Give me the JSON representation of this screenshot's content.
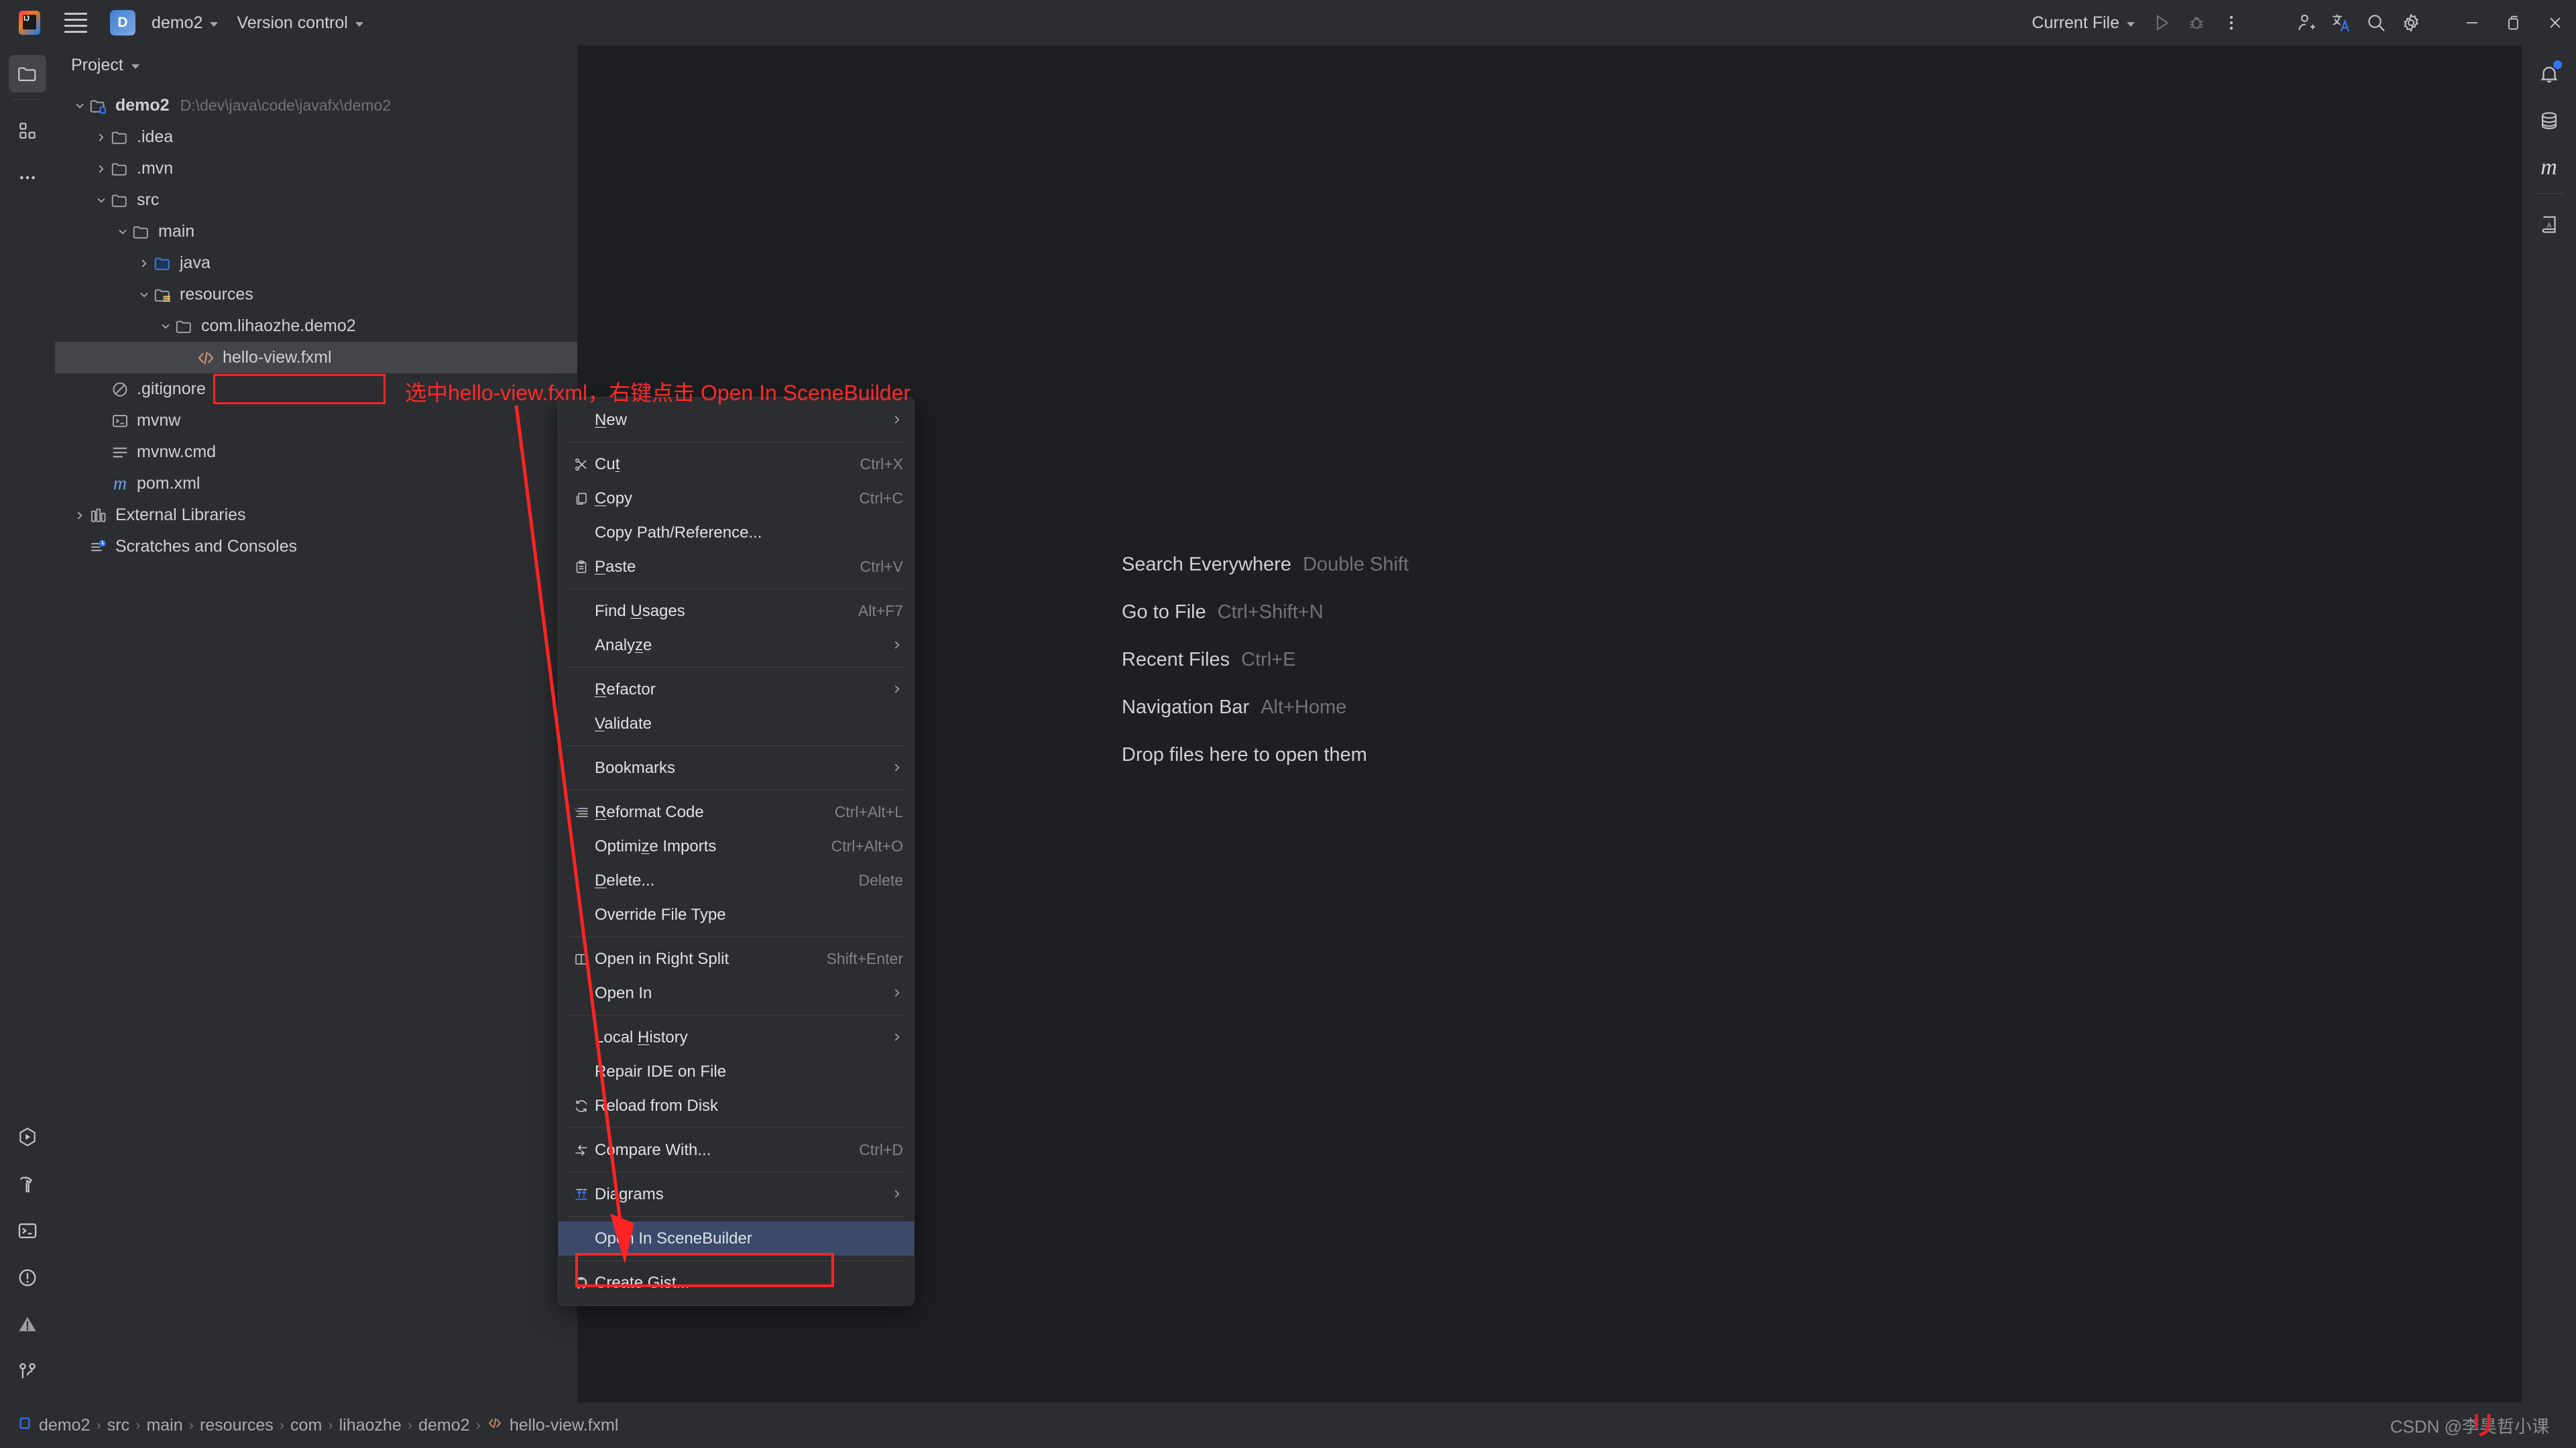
{
  "titlebar": {
    "logo_text": "IJ",
    "project_badge": "D",
    "project_name": "demo2",
    "version_control": "Version control",
    "run_config": "Current File",
    "icons": {
      "hamburger": "hamburger-menu-icon",
      "run": "run-icon",
      "debug": "debug-icon",
      "more": "more-vertical-icon",
      "add_user": "add-user-icon",
      "translate": "translate-icon",
      "search": "search-icon",
      "settings": "settings-gear-icon",
      "minimize": "minimize-icon",
      "maximize": "maximize-restore-icon",
      "close": "close-icon"
    }
  },
  "left_rail": {
    "items": [
      {
        "name": "project-tool-window",
        "icon": "folder-icon",
        "active": true
      },
      {
        "name": "commit-tool-window",
        "icon": "commit-grid-icon",
        "active": false
      },
      {
        "name": "more-tool-windows",
        "icon": "ellipsis-icon",
        "active": false
      }
    ],
    "bottom_items": [
      {
        "name": "run-tool-window",
        "icon": "run-hexagon-icon"
      },
      {
        "name": "build-tool-window",
        "icon": "hammer-icon"
      },
      {
        "name": "terminal-tool-window",
        "icon": "terminal-icon"
      },
      {
        "name": "problems-tool-window",
        "icon": "exclamation-circle-icon"
      },
      {
        "name": "warnings-tool-window",
        "icon": "warning-triangle-icon"
      },
      {
        "name": "version-control-tool-window",
        "icon": "git-branch-icon"
      }
    ]
  },
  "right_rail": {
    "items": [
      {
        "name": "notifications",
        "icon": "bell-icon",
        "badge": true
      },
      {
        "name": "database",
        "icon": "database-icon",
        "badge": false
      },
      {
        "name": "maven",
        "icon": "maven-m-icon",
        "badge": false
      },
      {
        "name": "translation-dictionary",
        "icon": "book-a-icon",
        "badge": false
      }
    ]
  },
  "project_panel": {
    "title": "Project",
    "tree": [
      {
        "depth": 0,
        "arrow": "down",
        "icon": "module-folder-icon",
        "label": "demo2",
        "path": "D:\\dev\\java\\code\\javafx\\demo2",
        "selected": false,
        "bold": true
      },
      {
        "depth": 1,
        "arrow": "right",
        "icon": "folder-icon",
        "label": ".idea",
        "path": "",
        "selected": false,
        "bold": false
      },
      {
        "depth": 1,
        "arrow": "right",
        "icon": "folder-icon",
        "label": ".mvn",
        "path": "",
        "selected": false,
        "bold": false
      },
      {
        "depth": 1,
        "arrow": "down",
        "icon": "folder-icon",
        "label": "src",
        "path": "",
        "selected": false,
        "bold": false
      },
      {
        "depth": 2,
        "arrow": "down",
        "icon": "folder-icon",
        "label": "main",
        "path": "",
        "selected": false,
        "bold": false
      },
      {
        "depth": 3,
        "arrow": "right",
        "icon": "source-folder-icon",
        "label": "java",
        "path": "",
        "selected": false,
        "bold": false
      },
      {
        "depth": 3,
        "arrow": "down",
        "icon": "resources-folder-icon",
        "label": "resources",
        "path": "",
        "selected": false,
        "bold": false
      },
      {
        "depth": 4,
        "arrow": "down",
        "icon": "folder-icon",
        "label": "com.lihaozhe.demo2",
        "path": "",
        "selected": false,
        "bold": false
      },
      {
        "depth": 5,
        "arrow": "none",
        "icon": "fxml-file-icon",
        "label": "hello-view.fxml",
        "path": "",
        "selected": true,
        "bold": false
      },
      {
        "depth": 1,
        "arrow": "none",
        "icon": "gitignore-icon",
        "label": ".gitignore",
        "path": "",
        "selected": false,
        "bold": false
      },
      {
        "depth": 1,
        "arrow": "none",
        "icon": "shell-script-icon",
        "label": "mvnw",
        "path": "",
        "selected": false,
        "bold": false
      },
      {
        "depth": 1,
        "arrow": "none",
        "icon": "cmd-file-icon",
        "label": "mvnw.cmd",
        "path": "",
        "selected": false,
        "bold": false
      },
      {
        "depth": 1,
        "arrow": "none",
        "icon": "maven-pom-icon",
        "label": "pom.xml",
        "path": "",
        "selected": false,
        "bold": false
      },
      {
        "depth": 0,
        "arrow": "right",
        "icon": "libraries-icon",
        "label": "External Libraries",
        "path": "",
        "selected": false,
        "bold": false
      },
      {
        "depth": 0,
        "arrow": "none",
        "icon": "scratches-icon",
        "label": "Scratches and Consoles",
        "path": "",
        "selected": false,
        "bold": false
      }
    ]
  },
  "editor": {
    "hints": [
      {
        "name": "Search Everywhere",
        "key": "Double Shift"
      },
      {
        "name": "Go to File",
        "key": "Ctrl+Shift+N"
      },
      {
        "name": "Recent Files",
        "key": "Ctrl+E"
      },
      {
        "name": "Navigation Bar",
        "key": "Alt+Home"
      },
      {
        "name": "Drop files here to open them",
        "key": ""
      }
    ]
  },
  "context_menu": {
    "items": [
      {
        "type": "item",
        "label": "New",
        "mnemonic": "N",
        "key": "",
        "icon": "",
        "submenu": true,
        "highlight": false
      },
      {
        "type": "sep"
      },
      {
        "type": "item",
        "label": "Cut",
        "mnemonic": "t",
        "key": "Ctrl+X",
        "icon": "scissors-icon",
        "submenu": false,
        "highlight": false
      },
      {
        "type": "item",
        "label": "Copy",
        "mnemonic": "C",
        "key": "Ctrl+C",
        "icon": "copy-icon",
        "submenu": false,
        "highlight": false
      },
      {
        "type": "item",
        "label": "Copy Path/Reference...",
        "mnemonic": "",
        "key": "",
        "icon": "",
        "submenu": false,
        "highlight": false
      },
      {
        "type": "item",
        "label": "Paste",
        "mnemonic": "P",
        "key": "Ctrl+V",
        "icon": "paste-icon",
        "submenu": false,
        "highlight": false
      },
      {
        "type": "sep"
      },
      {
        "type": "item",
        "label": "Find Usages",
        "mnemonic": "U",
        "key": "Alt+F7",
        "icon": "",
        "submenu": false,
        "highlight": false
      },
      {
        "type": "item",
        "label": "Analyze",
        "mnemonic": "z",
        "key": "",
        "icon": "",
        "submenu": true,
        "highlight": false
      },
      {
        "type": "sep"
      },
      {
        "type": "item",
        "label": "Refactor",
        "mnemonic": "R",
        "key": "",
        "icon": "",
        "submenu": true,
        "highlight": false
      },
      {
        "type": "item",
        "label": "Validate",
        "mnemonic": "V",
        "key": "",
        "icon": "",
        "submenu": false,
        "highlight": false
      },
      {
        "type": "sep"
      },
      {
        "type": "item",
        "label": "Bookmarks",
        "mnemonic": "",
        "key": "",
        "icon": "",
        "submenu": true,
        "highlight": false
      },
      {
        "type": "sep"
      },
      {
        "type": "item",
        "label": "Reformat Code",
        "mnemonic": "R",
        "key": "Ctrl+Alt+L",
        "icon": "reformat-icon",
        "submenu": false,
        "highlight": false
      },
      {
        "type": "item",
        "label": "Optimize Imports",
        "mnemonic": "z",
        "key": "Ctrl+Alt+O",
        "icon": "",
        "submenu": false,
        "highlight": false
      },
      {
        "type": "item",
        "label": "Delete...",
        "mnemonic": "D",
        "key": "Delete",
        "icon": "",
        "submenu": false,
        "highlight": false
      },
      {
        "type": "item",
        "label": "Override File Type",
        "mnemonic": "",
        "key": "",
        "icon": "",
        "submenu": false,
        "highlight": false
      },
      {
        "type": "sep"
      },
      {
        "type": "item",
        "label": "Open in Right Split",
        "mnemonic": "",
        "key": "Shift+Enter",
        "icon": "split-right-icon",
        "submenu": false,
        "highlight": false
      },
      {
        "type": "item",
        "label": "Open In",
        "mnemonic": "",
        "key": "",
        "icon": "",
        "submenu": true,
        "highlight": false
      },
      {
        "type": "sep"
      },
      {
        "type": "item",
        "label": "Local History",
        "mnemonic": "H",
        "key": "",
        "icon": "",
        "submenu": true,
        "highlight": false
      },
      {
        "type": "item",
        "label": "Repair IDE on File",
        "mnemonic": "",
        "key": "",
        "icon": "",
        "submenu": false,
        "highlight": false
      },
      {
        "type": "item",
        "label": "Reload from Disk",
        "mnemonic": "",
        "key": "",
        "icon": "reload-icon",
        "submenu": false,
        "highlight": false
      },
      {
        "type": "sep"
      },
      {
        "type": "item",
        "label": "Compare With...",
        "mnemonic": "",
        "key": "Ctrl+D",
        "icon": "compare-icon",
        "submenu": false,
        "highlight": false
      },
      {
        "type": "sep"
      },
      {
        "type": "item",
        "label": "Diagrams",
        "mnemonic": "",
        "key": "",
        "icon": "diagrams-icon",
        "submenu": true,
        "highlight": false
      },
      {
        "type": "sep"
      },
      {
        "type": "item",
        "label": "Open In SceneBuilder",
        "mnemonic": "",
        "key": "",
        "icon": "",
        "submenu": false,
        "highlight": true
      },
      {
        "type": "sep"
      },
      {
        "type": "item",
        "label": "Create Gist...",
        "mnemonic": "",
        "key": "",
        "icon": "github-icon",
        "submenu": false,
        "highlight": false
      }
    ]
  },
  "annotation": {
    "text": "选中hello-view.fxml，右键点击 Open In SceneBuilder",
    "color": "#ff2424"
  },
  "statusbar": {
    "breadcrumbs": [
      "demo2",
      "src",
      "main",
      "resources",
      "com",
      "lihaozhe",
      "demo2",
      "hello-view.fxml"
    ],
    "separator": "›",
    "watermark": "CSDN @李昊哲小课"
  },
  "colors": {
    "app_bg": "#1e1f22",
    "panel_bg": "#2b2d30",
    "selection": "#43454a",
    "menu_highlight": "#3b4a6b",
    "accent_blue": "#3574f0",
    "fxml_orange": "#cf8e6d",
    "annotation_red": "#ff2424",
    "text_primary": "#ced0d6",
    "text_secondary": "#6f737a"
  }
}
